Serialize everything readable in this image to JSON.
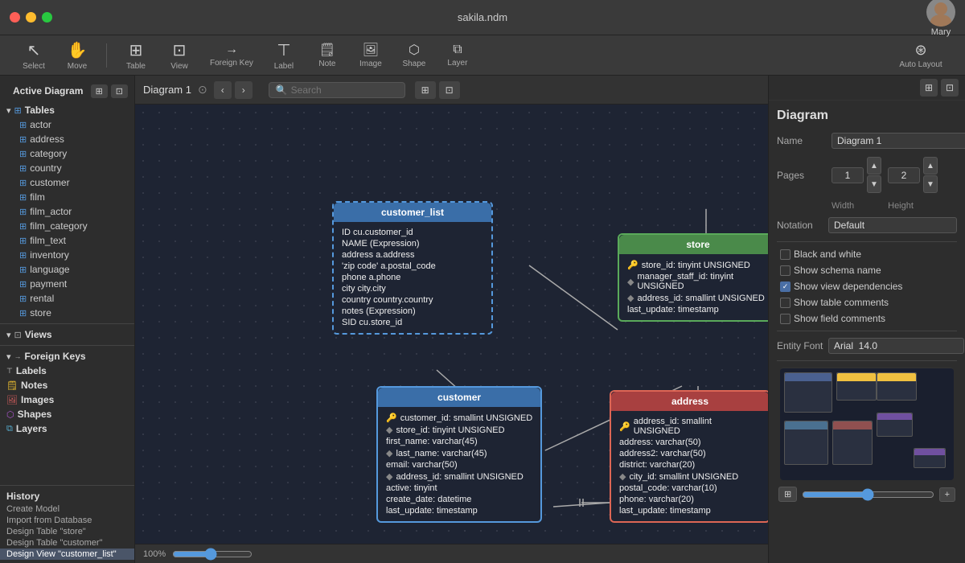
{
  "titlebar": {
    "title": "sakila.ndm",
    "user": "Mary"
  },
  "toolbar": {
    "items": [
      {
        "id": "select",
        "icon": "↖",
        "label": "Select"
      },
      {
        "id": "move",
        "icon": "✋",
        "label": "Move"
      },
      {
        "id": "table",
        "icon": "⊞",
        "label": "Table"
      },
      {
        "id": "view",
        "icon": "⊡",
        "label": "View"
      },
      {
        "id": "foreign-key",
        "icon": "→",
        "label": "Foreign Key"
      },
      {
        "id": "label",
        "icon": "⊤",
        "label": "Label"
      },
      {
        "id": "note",
        "icon": "📝",
        "label": "Note"
      },
      {
        "id": "image",
        "icon": "🖼",
        "label": "Image"
      },
      {
        "id": "shape",
        "icon": "⬡",
        "label": "Shape"
      },
      {
        "id": "layer",
        "icon": "⧉",
        "label": "Layer"
      }
    ],
    "auto_layout": "Auto Layout"
  },
  "sidebar": {
    "header": "Active Diagram",
    "sections": {
      "tables": {
        "label": "Tables",
        "items": [
          "actor",
          "address",
          "category",
          "country",
          "customer",
          "film",
          "film_actor",
          "film_category",
          "film_text",
          "inventory",
          "language",
          "payment",
          "rental",
          "store"
        ]
      },
      "views": {
        "label": "Views"
      },
      "foreign_keys": {
        "label": "Foreign Keys"
      },
      "labels": {
        "label": "Labels"
      },
      "notes": {
        "label": "Notes"
      },
      "images": {
        "label": "Images"
      },
      "shapes": {
        "label": "Shapes"
      },
      "layers": {
        "label": "Layers"
      }
    }
  },
  "history": {
    "title": "History",
    "items": [
      {
        "label": "Create Model",
        "active": false
      },
      {
        "label": "Import from Database",
        "active": false
      },
      {
        "label": "Design Table \"store\"",
        "active": false
      },
      {
        "label": "Design Table \"customer\"",
        "active": false
      },
      {
        "label": "Design View \"customer_list\"",
        "active": true
      }
    ]
  },
  "canvas": {
    "diagram_label": "Diagram 1",
    "search_placeholder": "Search",
    "tables": {
      "customer_list": {
        "title": "customer_list",
        "fields": [
          {
            "icon": "",
            "text": "ID cu.customer_id"
          },
          {
            "icon": "",
            "text": "NAME (Expression)"
          },
          {
            "icon": "",
            "text": "address a.address"
          },
          {
            "icon": "",
            "text": "'zip code' a.postal_code"
          },
          {
            "icon": "",
            "text": "phone a.phone"
          },
          {
            "icon": "",
            "text": "city city.city"
          },
          {
            "icon": "",
            "text": "country country.country"
          },
          {
            "icon": "",
            "text": "notes (Expression)"
          },
          {
            "icon": "",
            "text": "SID cu.store_id"
          }
        ]
      },
      "store": {
        "title": "store",
        "fields": [
          {
            "icon": "🔑",
            "text": "store_id: tinyint UNSIGNED"
          },
          {
            "icon": "◆",
            "text": "manager_staff_id: tinyint UNSIGNED"
          },
          {
            "icon": "◆",
            "text": "address_id: smallint UNSIGNED"
          },
          {
            "icon": "",
            "text": "last_update: timestamp"
          }
        ]
      },
      "customer": {
        "title": "customer",
        "fields": [
          {
            "icon": "🔑",
            "text": "customer_id: smallint UNSIGNED"
          },
          {
            "icon": "◆",
            "text": "store_id: tinyint UNSIGNED"
          },
          {
            "icon": "",
            "text": "first_name: varchar(45)"
          },
          {
            "icon": "◆",
            "text": "last_name: varchar(45)"
          },
          {
            "icon": "",
            "text": "email: varchar(50)"
          },
          {
            "icon": "◆",
            "text": "address_id: smallint UNSIGNED"
          },
          {
            "icon": "",
            "text": "active: tinyint"
          },
          {
            "icon": "",
            "text": "create_date: datetime"
          },
          {
            "icon": "",
            "text": "last_update: timestamp"
          }
        ]
      },
      "address": {
        "title": "address",
        "fields": [
          {
            "icon": "🔑",
            "text": "address_id: smallint UNSIGNED"
          },
          {
            "icon": "",
            "text": "address: varchar(50)"
          },
          {
            "icon": "",
            "text": "address2: varchar(50)"
          },
          {
            "icon": "",
            "text": "district: varchar(20)"
          },
          {
            "icon": "◆",
            "text": "city_id: smallint UNSIGNED"
          },
          {
            "icon": "",
            "text": "postal_code: varchar(10)"
          },
          {
            "icon": "",
            "text": "phone: varchar(20)"
          },
          {
            "icon": "",
            "text": "last_update: timestamp"
          }
        ]
      }
    }
  },
  "right_panel": {
    "title": "Diagram",
    "name_label": "Name",
    "name_value": "Diagram 1",
    "pages_label": "Pages",
    "pages_width": "1",
    "pages_height": "2",
    "width_label": "Width",
    "height_label": "Height",
    "notation_label": "Notation",
    "notation_value": "Default",
    "checkboxes": [
      {
        "id": "black-white",
        "label": "Black and white",
        "checked": false
      },
      {
        "id": "schema-name",
        "label": "Show schema name",
        "checked": false
      },
      {
        "id": "view-deps",
        "label": "Show view dependencies",
        "checked": true
      },
      {
        "id": "table-comments",
        "label": "Show table comments",
        "checked": false
      },
      {
        "id": "field-comments",
        "label": "Show field comments",
        "checked": false
      }
    ],
    "entity_font_label": "Entity Font",
    "entity_font_value": "Arial  14.0",
    "entity_font_btn": "..."
  },
  "bottom_bar": {
    "zoom": "100%"
  }
}
